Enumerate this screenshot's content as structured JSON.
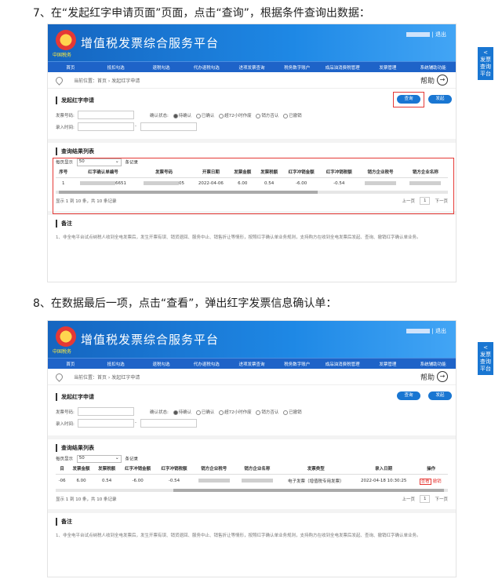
{
  "step7": "7、在“发起红字申请页面”页面，点击“查询”，根据条件查询出数据：",
  "step8": "8、在数据最后一项，点击“查看”，弹出红字发票信息确认单：",
  "app": {
    "title": "增值税发票综合服务平台",
    "emblem_text": "中国税务",
    "user_sep": "|",
    "user_exit": "退出"
  },
  "nav": [
    "首页",
    "抵扣勾选",
    "退税勾选",
    "代办退税勾选",
    "进项发票查询",
    "税务数字账户",
    "成品油消费税管理",
    "发票管理",
    "系统辅助功能"
  ],
  "side_tab": "发票查询平台",
  "side_arrow": "<",
  "breadcrumb": "当前位置：首页 › 发起红字申请",
  "help": "帮助",
  "help_icon": "→",
  "apply": {
    "title": "发起红字申请",
    "query_btn": "查询",
    "apply_btn": "发起",
    "invoice_no_label": "发票号码:",
    "confirm_status_label": "确认状态:",
    "status_options": [
      "待确认",
      "已确认",
      "超72小时作废",
      "销方否认",
      "已撤销"
    ],
    "entry_time_label": "录入时间:",
    "date_sep": "-"
  },
  "results": {
    "title": "查询结果列表",
    "per_page_label": "每页显示",
    "per_page_value": "50",
    "per_page_unit": "条记录",
    "columns": [
      "序号",
      "红字确认单编号",
      "发票号码",
      "开票日期",
      "发票金额",
      "发票税额",
      "红字冲销金额",
      "红字冲销税额",
      "销方企业税号",
      "销方企业名称"
    ],
    "row": {
      "seq": "1",
      "confirm_no_tail": "6651",
      "invoice_no_tail": "05",
      "date": "2022-04-06",
      "amount": "6.00",
      "tax": "0.54",
      "red_amount": "-6.00",
      "red_tax": "-0.54"
    },
    "columns_b": [
      "目",
      "发票金额",
      "发票税额",
      "红字冲销金额",
      "红字冲销税额",
      "销方企业税号",
      "销方企业名称",
      "发票类型",
      "录入日期",
      "操作"
    ],
    "row_b": {
      "seq": "-06",
      "amount": "6.00",
      "tax": "0.54",
      "red_amount": "-6.00",
      "red_tax": "-0.54",
      "type": "电子发票（增值税专用发票）",
      "entry_date": "2022-04-18 10:30:25",
      "view": "查看",
      "undo": "撤销"
    },
    "summary": "显示 1 到 10 条，共 10 条记录",
    "prev": "上一页",
    "page": "1",
    "next": "下一页"
  },
  "notes": {
    "title": "备注",
    "text": "1、非全电平台试点纳税人收到全电发票后，发生开票有误、销货退回、服务中止、销售折让等情形，按照红字确认单业务规则，支持购方在收到全电发票后发起、查询、撤销红字确认单业务。"
  }
}
